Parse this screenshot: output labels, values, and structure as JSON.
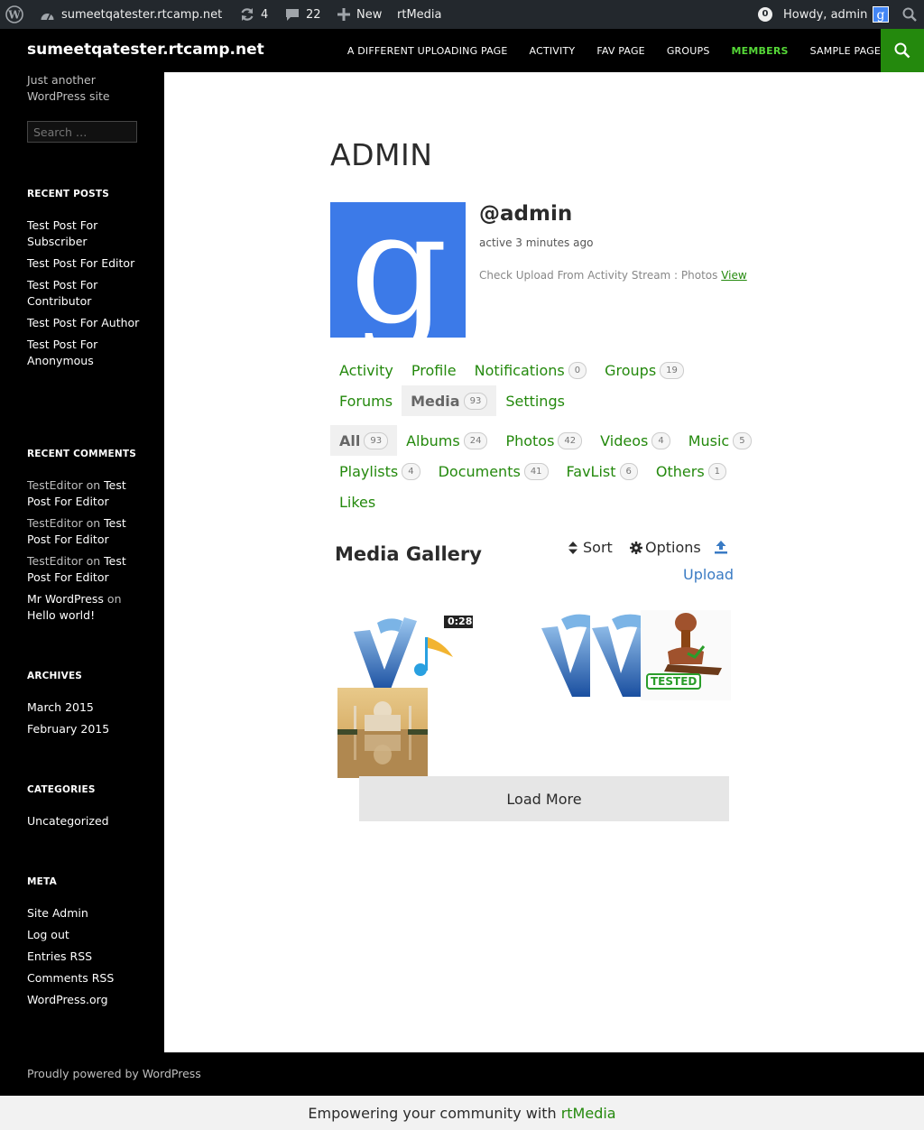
{
  "adminbar": {
    "site": "sumeetqatester.rtcamp.net",
    "updates": "4",
    "comments": "22",
    "new": "New",
    "plugin": "rtMedia",
    "notif_count": "0",
    "howdy": "Howdy, admin"
  },
  "header": {
    "site_title": "sumeetqatester.rtcamp.net",
    "nav": [
      "A DIFFERENT UPLOADING PAGE",
      "ACTIVITY",
      "FAV PAGE",
      "GROUPS",
      "MEMBERS",
      "SAMPLE PAGE"
    ],
    "active_nav": "MEMBERS"
  },
  "sidebar": {
    "description": "Just another WordPress site",
    "search_placeholder": "Search …",
    "recent_posts_title": "RECENT POSTS",
    "recent_posts": [
      "Test Post For Subscriber",
      "Test Post For Editor",
      "Test Post For Contributor",
      "Test Post For Author",
      "Test Post For Anonymous"
    ],
    "recent_comments_title": "RECENT COMMENTS",
    "recent_comments": [
      {
        "author": "TestEditor",
        "on": "on",
        "post": "Test Post For Editor"
      },
      {
        "author": "TestEditor",
        "on": "on",
        "post": "Test Post For Editor"
      },
      {
        "author": "TestEditor",
        "on": "on",
        "post": "Test Post For Editor"
      },
      {
        "author": "Mr WordPress",
        "on": "on",
        "post": "Hello world!"
      }
    ],
    "archives_title": "ARCHIVES",
    "archives": [
      "March 2015",
      "February 2015"
    ],
    "categories_title": "CATEGORIES",
    "categories": [
      "Uncategorized"
    ],
    "meta_title": "META",
    "meta": [
      "Site Admin",
      "Log out",
      "Entries RSS",
      "Comments RSS",
      "WordPress.org"
    ]
  },
  "profile": {
    "title": "ADMIN",
    "username": "@admin",
    "activity": "active 3 minutes ago",
    "latest_update": "Check Upload From Activity Stream : Photos",
    "latest_update_link": "View"
  },
  "member_nav": [
    {
      "label": "Activity"
    },
    {
      "label": "Profile"
    },
    {
      "label": "Notifications",
      "count": "0"
    },
    {
      "label": "Groups",
      "count": "19"
    },
    {
      "label": "Forums"
    },
    {
      "label": "Media",
      "count": "93"
    },
    {
      "label": "Settings"
    }
  ],
  "media_nav": [
    {
      "label": "All",
      "count": "93"
    },
    {
      "label": "Albums",
      "count": "24"
    },
    {
      "label": "Photos",
      "count": "42"
    },
    {
      "label": "Videos",
      "count": "4"
    },
    {
      "label": "Music",
      "count": "5"
    },
    {
      "label": "Playlists",
      "count": "4"
    },
    {
      "label": "Documents",
      "count": "41"
    },
    {
      "label": "FavList",
      "count": "6"
    },
    {
      "label": "Others",
      "count": "1"
    },
    {
      "label": "Likes"
    }
  ],
  "gallery": {
    "title": "Media Gallery",
    "sort": "Sort",
    "options": "Options",
    "upload": "Upload",
    "video_duration": "0:28",
    "load_more": "Load More",
    "stamp_text": "TESTED"
  },
  "footer": {
    "text": "Proudly powered by WordPress"
  },
  "rtbar": {
    "text": "Empowering your community with",
    "brand": "rtMedia"
  },
  "colors": {
    "accent": "#24890d",
    "active_nav": "#55d737",
    "link_blue": "#3a7bc4",
    "adminbar": "#23282d"
  }
}
